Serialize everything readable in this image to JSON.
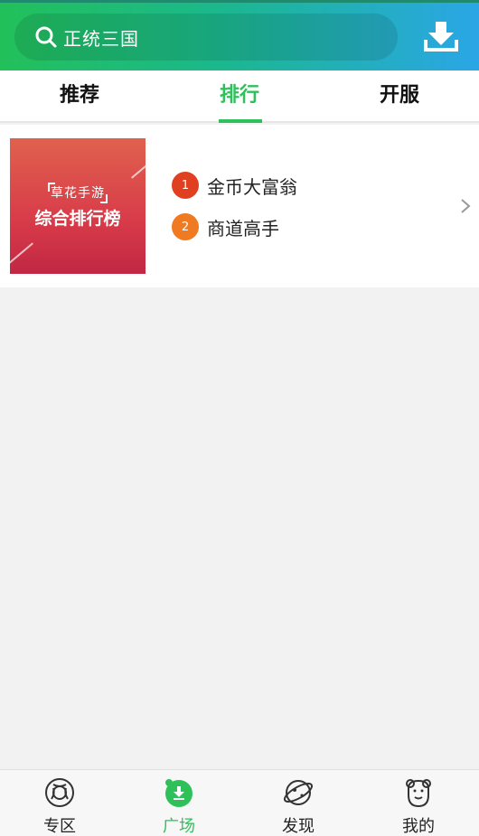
{
  "header": {
    "search_text": "正统三国",
    "icons": {
      "search": "search-icon",
      "download": "download-icon"
    }
  },
  "tabs": [
    {
      "label": "推荐",
      "active": false
    },
    {
      "label": "排行",
      "active": true
    },
    {
      "label": "开服",
      "active": false
    }
  ],
  "rank_card": {
    "banner": {
      "sub_text": "草花手游",
      "main_text": "综合排行榜"
    },
    "items": [
      {
        "rank": "1",
        "name": "金币大富翁",
        "color": "#e0401f"
      },
      {
        "rank": "2",
        "name": "商道高手",
        "color": "#f07a22"
      }
    ]
  },
  "bottom_nav": [
    {
      "label": "专区",
      "icon": "zone-icon",
      "active": false
    },
    {
      "label": "广场",
      "icon": "plaza-icon",
      "active": true
    },
    {
      "label": "发现",
      "icon": "discover-planet-icon",
      "active": false
    },
    {
      "label": "我的",
      "icon": "profile-bear-icon",
      "active": false
    }
  ],
  "colors": {
    "accent": "#2ec15a",
    "header_gradient_start": "#22c05a",
    "header_gradient_end": "#2aa6e6",
    "background": "#f2f2f2"
  }
}
